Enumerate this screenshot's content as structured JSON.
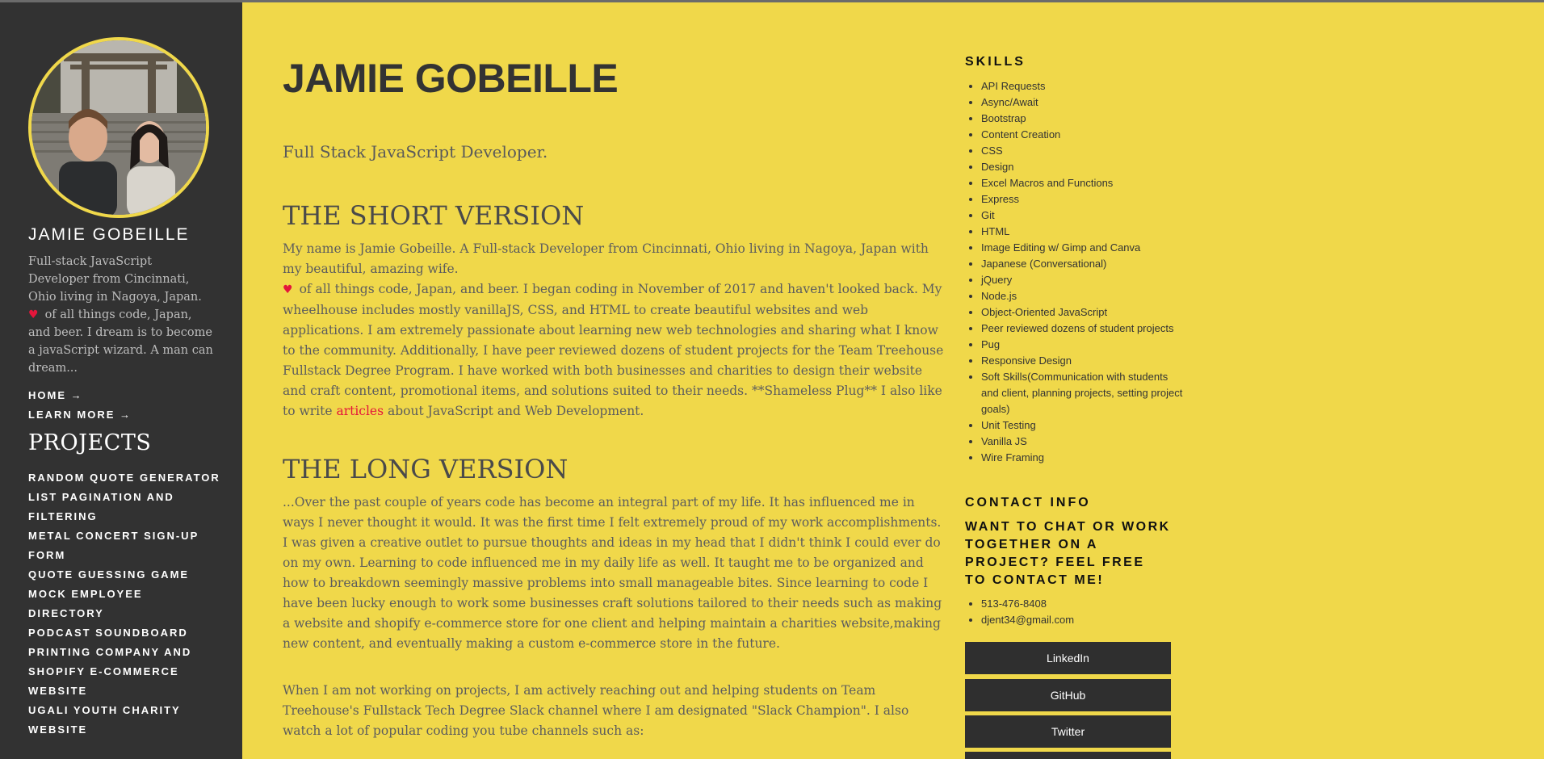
{
  "sidebar": {
    "name": "JAMIE GOBEILLE",
    "bio_line1": "Full-stack JavaScript Developer from Cincinnati, Ohio living in Nagoya, Japan.",
    "bio_line2": "of all things code, Japan, and beer. I dream is to become a javaScript wizard. A man can dream...",
    "nav": [
      {
        "label": "HOME →"
      },
      {
        "label": "LEARN MORE →"
      }
    ],
    "projects_title": "PROJECTS",
    "projects": [
      "RANDOM QUOTE GENERATOR",
      "LIST PAGINATION AND FILTERING",
      "METAL CONCERT SIGN-UP FORM",
      "QUOTE GUESSING GAME",
      "MOCK EMPLOYEE DIRECTORY",
      "PODCAST SOUNDBOARD",
      "PRINTING COMPANY AND SHOPIFY E-COMMERCE WEBSITE",
      "UGALI YOUTH CHARITY WEBSITE"
    ]
  },
  "main": {
    "title": "JAMIE GOBEILLE",
    "tagline": "Full Stack JavaScript Developer.",
    "short_title": "THE SHORT VERSION",
    "short_p1": "My name is Jamie Gobeille. A Full-stack Developer from Cincinnati, Ohio living in Nagoya, Japan with my beautiful, amazing wife.",
    "short_p2_before": "of all things code, Japan, and beer. I began coding in November of 2017 and haven't looked back. My wheelhouse includes mostly vanillaJS, CSS, and HTML to create beautiful websites and web applications. I am extremely passionate about learning new web technologies and sharing what I know to the community. Additionally, I have peer reviewed dozens of student projects for the Team Treehouse Fullstack Degree Program. I have worked with both businesses and charities to design their website and craft content, promotional items, and solutions suited to their needs. **Shameless Plug** I also like to write ",
    "short_link": "articles",
    "short_p2_after": " about JavaScript and Web Development.",
    "long_title": "THE LONG VERSION",
    "long_p1": "...Over the past couple of years code has become an integral part of my life. It has influenced me in ways I never thought it would. It was the first time I felt extremely proud of my work accomplishments. I was given a creative outlet to pursue thoughts and ideas in my head that I didn't think I could ever do on my own. Learning to code influenced me in my daily life as well. It taught me to be organized and how to breakdown seemingly massive problems into small manageable bites. Since learning to code I have been lucky enough to work some businesses craft solutions tailored to their needs such as making a website and shopify e-commerce store for one client and helping maintain a charities website,making new content, and eventually making a custom e-commerce store in the future.",
    "long_p2": "When I am not working on projects, I am actively reaching out and helping students on Team Treehouse's Fullstack Tech Degree Slack channel where I am designated \"Slack Champion\". I also watch a lot of popular coding you tube channels such as:"
  },
  "right": {
    "skills_title": "SKILLS",
    "skills": [
      "API Requests",
      "Async/Await",
      "Bootstrap",
      "Content Creation",
      "CSS",
      "Design",
      "Excel Macros and Functions",
      "Express",
      "Git",
      "HTML",
      "Image Editing w/ Gimp and Canva",
      "Japanese (Conversational)",
      "jQuery",
      "Node.js",
      "Object-Oriented JavaScript",
      "Peer reviewed dozens of student projects",
      "Pug",
      "Responsive Design",
      "Soft Skills(Communication with students and client, planning projects, setting project goals)",
      "Unit Testing",
      "Vanilla JS",
      "Wire Framing"
    ],
    "contact_title": "CONTACT INFO",
    "contact_lead": "WANT TO CHAT OR WORK TOGETHER ON A PROJECT? FEEL FREE TO CONTACT ME!",
    "phone": "513-476-8408",
    "email": "djent34@gmail.com",
    "buttons": [
      "LinkedIn",
      "GitHub",
      "Twitter"
    ]
  },
  "colors": {
    "background": "#f0d84a",
    "sidebar": "#323232",
    "accent": "#e4163b",
    "button": "#2f2f2f"
  },
  "icons": {
    "heart": "heart-icon"
  }
}
